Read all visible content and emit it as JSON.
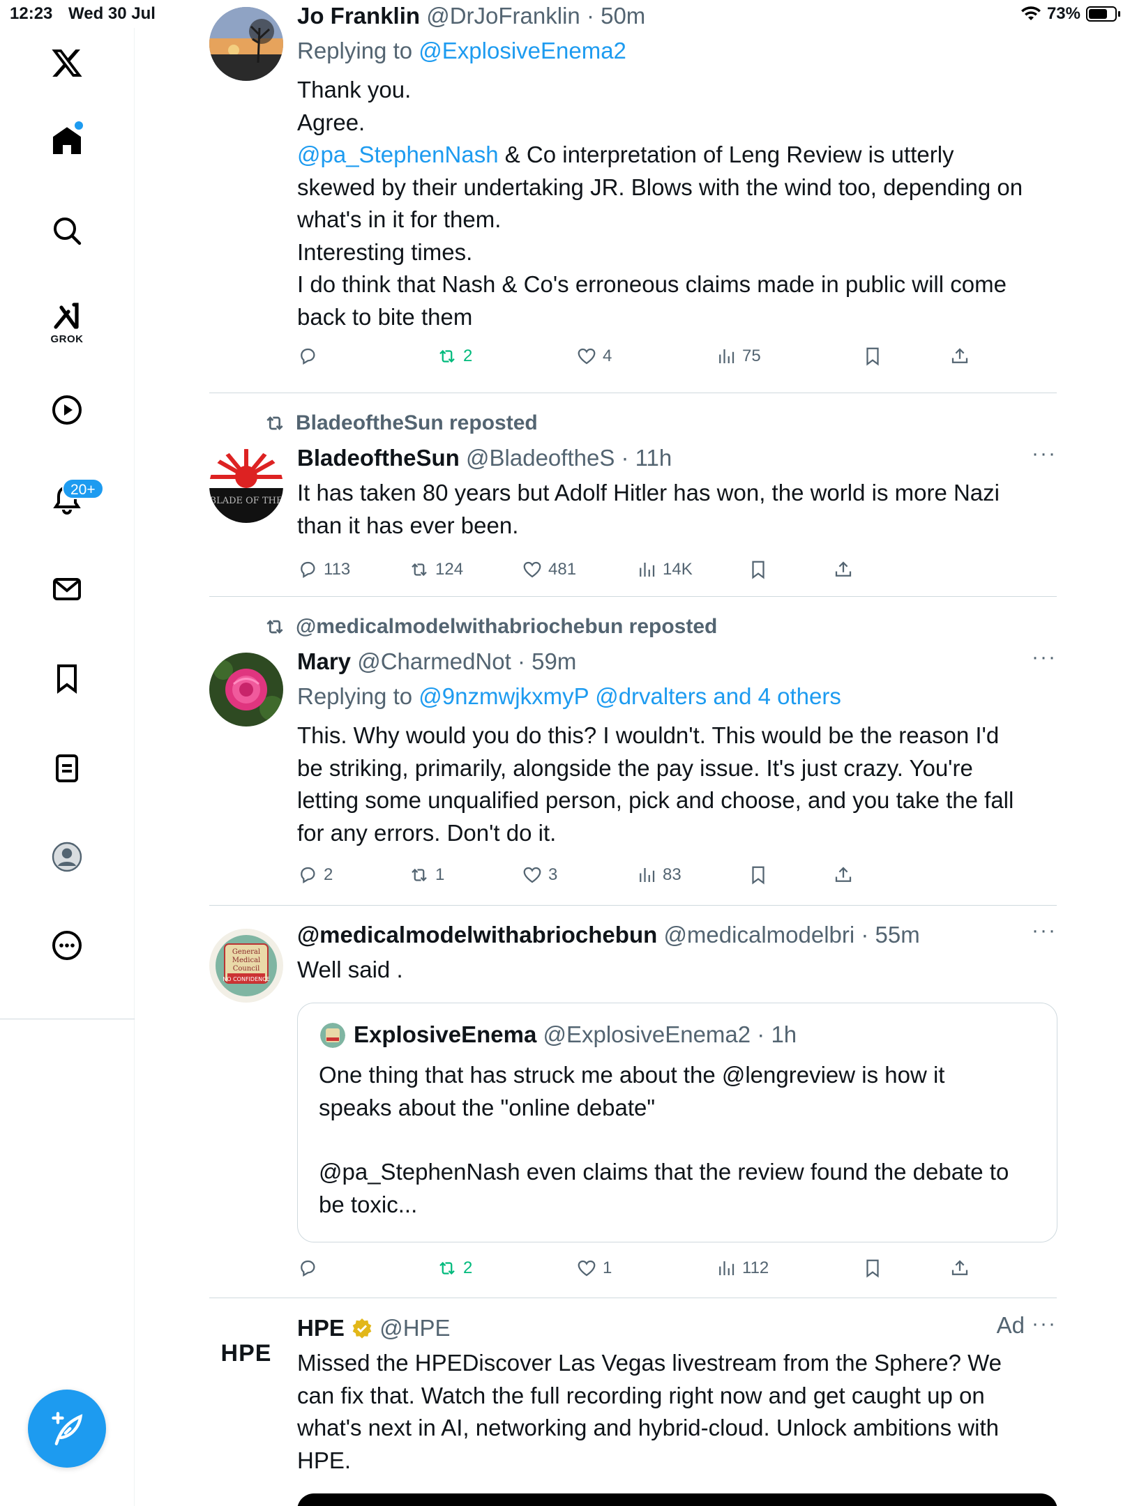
{
  "status": {
    "time": "12:23",
    "date": "Wed 30 Jul",
    "battery": "73%",
    "battery_level": 0.73
  },
  "nav": {
    "grok_label": "GROK",
    "notifications_badge": "20+",
    "icons": [
      "x-logo-icon",
      "home-icon",
      "search-icon",
      "grok-icon",
      "video-icon",
      "bell-icon",
      "mail-icon",
      "bookmark-icon",
      "lists-icon",
      "profile-icon",
      "more-icon",
      "compose-icon"
    ]
  },
  "posts": [
    {
      "name": "Jo Franklin",
      "handle": "@DrJoFranklin",
      "time": "· 50m",
      "reply_prefix": "Replying to ",
      "reply_to": "@ExplosiveEnema2",
      "lines": [
        "Thank you.",
        "Agree."
      ],
      "mention": "@pa_StephenNash",
      "line3_rest": " & Co interpretation of Leng Review is utterly",
      "line4": "skewed by their undertaking JR. Blows with the wind too, depending on",
      "line5": "what's in it for them.",
      "line6": "Interesting times.",
      "line7": "I do think that Nash & Co's erroneous claims made in public will come",
      "line8": "back to bite them",
      "reposts": "2",
      "likes": "4",
      "views": "75"
    },
    {
      "reposted_by": "BladeoftheSun reposted",
      "name": "BladeoftheSun",
      "handle": "@BladeoftheS",
      "time": "· 11h",
      "more": "···",
      "line1": "It has taken 80 years but Adolf Hitler has won, the world is more Nazi",
      "line2": "than it has ever been.",
      "replies": "113",
      "reposts": "124",
      "likes": "481",
      "views": "14K",
      "avatar_text": "BLADE OF THE"
    },
    {
      "reposted_by": "@medicalmodelwithabriochebun reposted",
      "name": "Mary",
      "handle": "@CharmedNot",
      "time": "· 59m",
      "more": "···",
      "reply_prefix": "Replying to ",
      "reply_to": "@9nzmwjkxmyP @drvalters and 4 others",
      "line1": "This.  Why would you do this?  I wouldn't.  This would be the reason I'd",
      "line2": "be striking, primarily, alongside the pay issue.  It's just crazy.  You're",
      "line3": "letting some unqualified person, pick and choose, and you take the fall",
      "line4": "for any errors. Don't do it.",
      "replies": "2",
      "reposts": "1",
      "likes": "3",
      "views": "83"
    },
    {
      "name": "@medicalmodelwithabriochebun",
      "handle": "@medicalmodelbri",
      "time": "· 55m",
      "more": "···",
      "line1": "Well said .",
      "avatar_text": "General Medical Council NO CONFIDENCE",
      "quote": {
        "name": "ExplosiveEnema",
        "handle": "@ExplosiveEnema2",
        "time": "· 1h",
        "line1": "One thing that has struck me about the @lengreview is how it",
        "line2": "speaks about the \"online debate\"",
        "line3": "@pa_StephenNash even claims that the review found the debate to",
        "line4": "be toxic..."
      },
      "reposts": "2",
      "likes": "1",
      "views": "112"
    },
    {
      "name": "HPE",
      "handle": "@HPE",
      "ad": "Ad",
      "more": "···",
      "logo_text": "HPE",
      "line1": "Missed the HPEDiscover Las Vegas livestream from the Sphere? We",
      "line2": "can fix that. Watch the full recording right now and get caught up on",
      "line3": "what's next in AI, networking and hybrid-cloud. Unlock ambitions with",
      "line4": "HPE."
    }
  ],
  "colors": {
    "accent": "#1d9bf0",
    "repost_green": "#00ba7c",
    "muted": "#536471",
    "divider": "#cfd9de"
  }
}
